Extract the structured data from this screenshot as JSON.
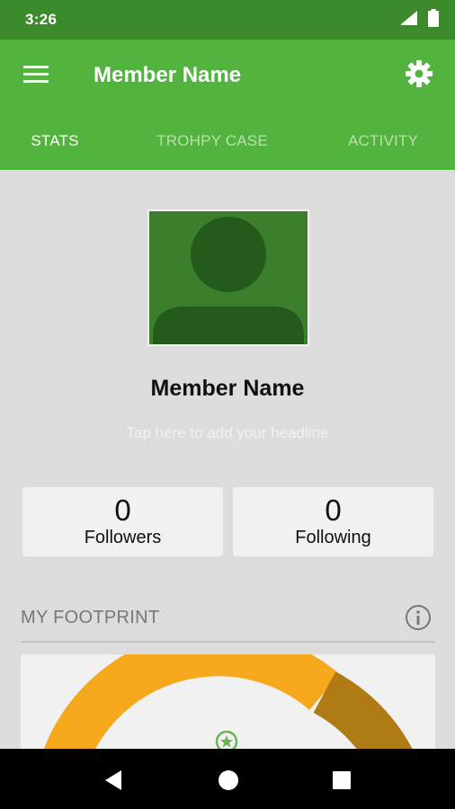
{
  "status_bar": {
    "time": "3:26",
    "icons": [
      "signal-icon",
      "battery-icon"
    ]
  },
  "app_bar": {
    "title": "Member Name",
    "left_icon": "menu-icon",
    "right_icon": "gear-icon"
  },
  "tabs": [
    {
      "label": "STATS",
      "active": true
    },
    {
      "label": "TROHPY CASE",
      "active": false
    },
    {
      "label": "ACTIVITY",
      "active": false
    }
  ],
  "profile": {
    "name": "Member Name",
    "headline_placeholder": "Tap here to add your headline",
    "avatar_icon": "person-placeholder-icon"
  },
  "stats": {
    "followers": {
      "count": "0",
      "label": "Followers"
    },
    "following": {
      "count": "0",
      "label": "Following"
    }
  },
  "footprint": {
    "title": "MY FOOTPRINT",
    "info_icon": "info-icon"
  },
  "colors": {
    "status_bar": "#3c8a2b",
    "app_bar": "#52b33f",
    "tab_inactive": "#b8e0ab",
    "content_bg": "#dcdcdc",
    "avatar_bg": "#3b7f2c",
    "avatar_figure": "#245a1c",
    "gauge_main": "#f5a81c",
    "gauge_secondary": "#b07a14"
  },
  "nav_bar": {
    "icons": [
      "back-icon",
      "home-icon",
      "recents-icon"
    ]
  }
}
